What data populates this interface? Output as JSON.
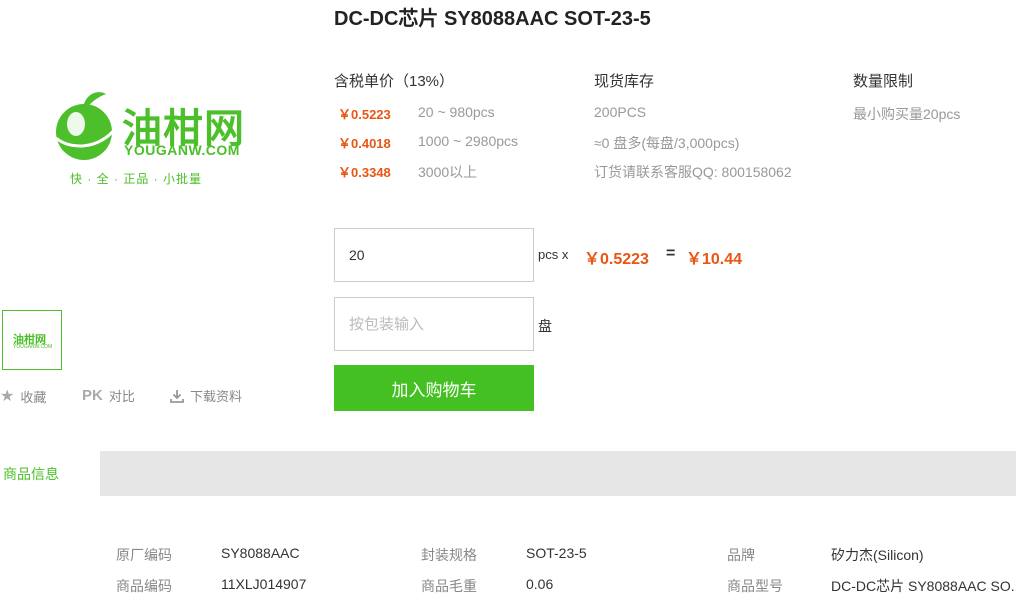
{
  "product": {
    "title": "DC-DC芯片 SY8088AAC SOT-23-5"
  },
  "logo": {
    "brand": "油柑网",
    "domain": "YOUGANW.COM",
    "slogan": "快 · 全 · 正品 · 小批量",
    "thumb_brand": "油柑网",
    "thumb_domain": "YOUGANW.COM"
  },
  "actions": {
    "favorite": "收藏",
    "pk_badge": "PK",
    "compare": "对比",
    "download": "下载资料"
  },
  "pricing": {
    "price_header": "含税单价（13%）",
    "tiers": [
      {
        "price": "￥0.5223",
        "range": "20 ~ 980pcs"
      },
      {
        "price": "￥0.4018",
        "range": "1000 ~ 2980pcs"
      },
      {
        "price": "￥0.3348",
        "range": "3000以上"
      }
    ],
    "stock_header": "现货库存",
    "stock_lines": [
      "200PCS",
      "≈0 盘多(每盘/3,000pcs)",
      "订货请联系客服QQ: 800158062"
    ],
    "limit_header": "数量限制",
    "limit_text": "最小购买量20pcs"
  },
  "order": {
    "quantity": "20",
    "unit": "pcs x",
    "unit_price": "￥0.5223",
    "equals": "=",
    "total": "￥10.44",
    "pack_placeholder": "按包装输入",
    "pack_unit": "盘",
    "add_to_cart": "加入购物车"
  },
  "tabs": {
    "active": "商品信息"
  },
  "info": {
    "rows": [
      [
        "原厂编码",
        "SY8088AAC",
        "封装规格",
        "SOT-23-5",
        "品牌",
        "矽力杰(Silicon)"
      ],
      [
        "商品编码",
        "11XLJ014907",
        "商品毛重",
        "0.06",
        "商品型号",
        "DC-DC芯片 SY8088AAC SO..."
      ]
    ]
  },
  "colors": {
    "brand_green": "#4cbf2a",
    "price_orange": "#e95513",
    "button_green": "#44c022",
    "tab_bar_grey": "#e6e6e6"
  }
}
